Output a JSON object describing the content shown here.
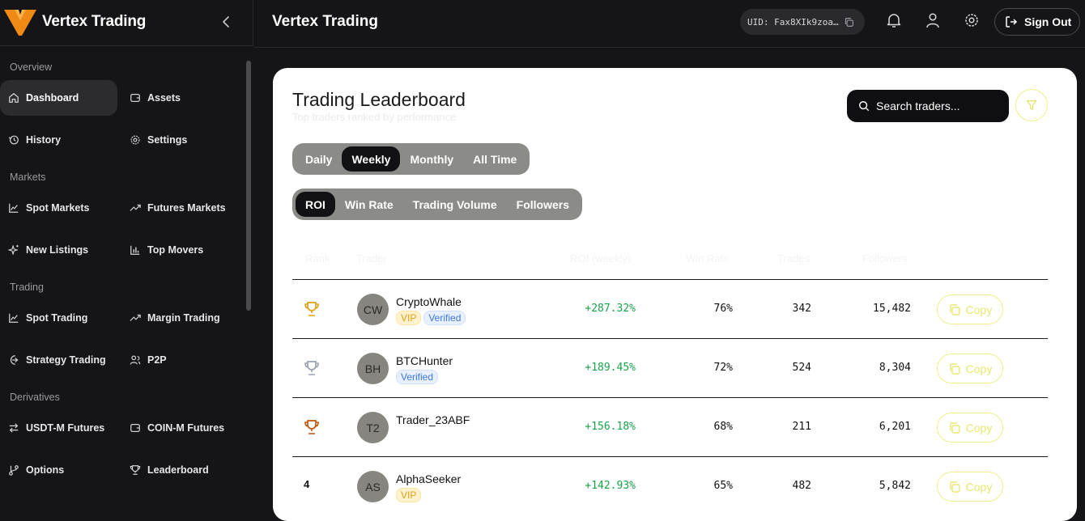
{
  "brand": {
    "name": "Vertex Trading",
    "accent": "#f08a14"
  },
  "sidebar": {
    "sections": [
      {
        "label": "Overview"
      },
      {
        "label": "Markets"
      },
      {
        "label": "Trading"
      },
      {
        "label": "Derivatives"
      }
    ],
    "items": [
      {
        "label": "Dashboard",
        "icon": "home-icon",
        "active": true
      },
      {
        "label": "Assets",
        "icon": "wallet-icon"
      },
      {
        "label": "History",
        "icon": "history-icon"
      },
      {
        "label": "Settings",
        "icon": "gear-icon"
      },
      {
        "label": "Spot Markets",
        "icon": "line-chart-icon"
      },
      {
        "label": "Futures Markets",
        "icon": "trending-up-icon"
      },
      {
        "label": "New Listings",
        "icon": "sparkles-icon"
      },
      {
        "label": "Top Movers",
        "icon": "bar-chart-icon"
      },
      {
        "label": "Spot Trading",
        "icon": "line-chart-icon"
      },
      {
        "label": "Margin Trading",
        "icon": "trending-up-icon"
      },
      {
        "label": "Strategy Trading",
        "icon": "strategy-icon"
      },
      {
        "label": "P2P",
        "icon": "users-icon"
      },
      {
        "label": "USDT-M Futures",
        "icon": "arrows-exchange-icon"
      },
      {
        "label": "COIN-M Futures",
        "icon": "wallet-icon"
      },
      {
        "label": "Options",
        "icon": "git-branch-icon"
      },
      {
        "label": "Leaderboard",
        "icon": "trophy-icon"
      }
    ]
  },
  "header": {
    "title": "Vertex Trading",
    "uid": "UID: Fax8XIk9zoa…",
    "sign_out": "Sign Out"
  },
  "leaderboard": {
    "title": "Trading Leaderboard",
    "subtitle": "Top traders ranked by performance",
    "search_placeholder": "Search traders...",
    "period_tabs": [
      "Daily",
      "Weekly",
      "Monthly",
      "All Time"
    ],
    "period_selected": "Weekly",
    "metric_tabs": [
      "ROI",
      "Win Rate",
      "Trading Volume",
      "Followers"
    ],
    "metric_selected": "ROI",
    "columns": [
      "Rank",
      "Trader",
      "ROI (weekly)",
      "Win Rate",
      "Trades",
      "Followers"
    ],
    "copy_label": "Copy",
    "rows": [
      {
        "rank": "1",
        "trophy": "gold",
        "initials": "CW",
        "name": "CryptoWhale",
        "vip": "VIP",
        "verified": "Verified",
        "roi": "+287.32%",
        "win_rate": "76%",
        "trades": "342",
        "followers": "15,482"
      },
      {
        "rank": "2",
        "trophy": "silver",
        "initials": "BH",
        "name": "BTCHunter",
        "vip": "",
        "verified": "Verified",
        "roi": "+189.45%",
        "win_rate": "72%",
        "trades": "524",
        "followers": "8,304"
      },
      {
        "rank": "3",
        "trophy": "bronze",
        "initials": "T2",
        "name": "Trader_23ABF",
        "vip": "",
        "verified": "",
        "roi": "+156.18%",
        "win_rate": "68%",
        "trades": "211",
        "followers": "6,201"
      },
      {
        "rank": "4",
        "trophy": "",
        "initials": "AS",
        "name": "AlphaSeeker",
        "vip": "VIP",
        "verified": "",
        "roi": "+142.93%",
        "win_rate": "65%",
        "trades": "482",
        "followers": "5,842"
      }
    ]
  }
}
